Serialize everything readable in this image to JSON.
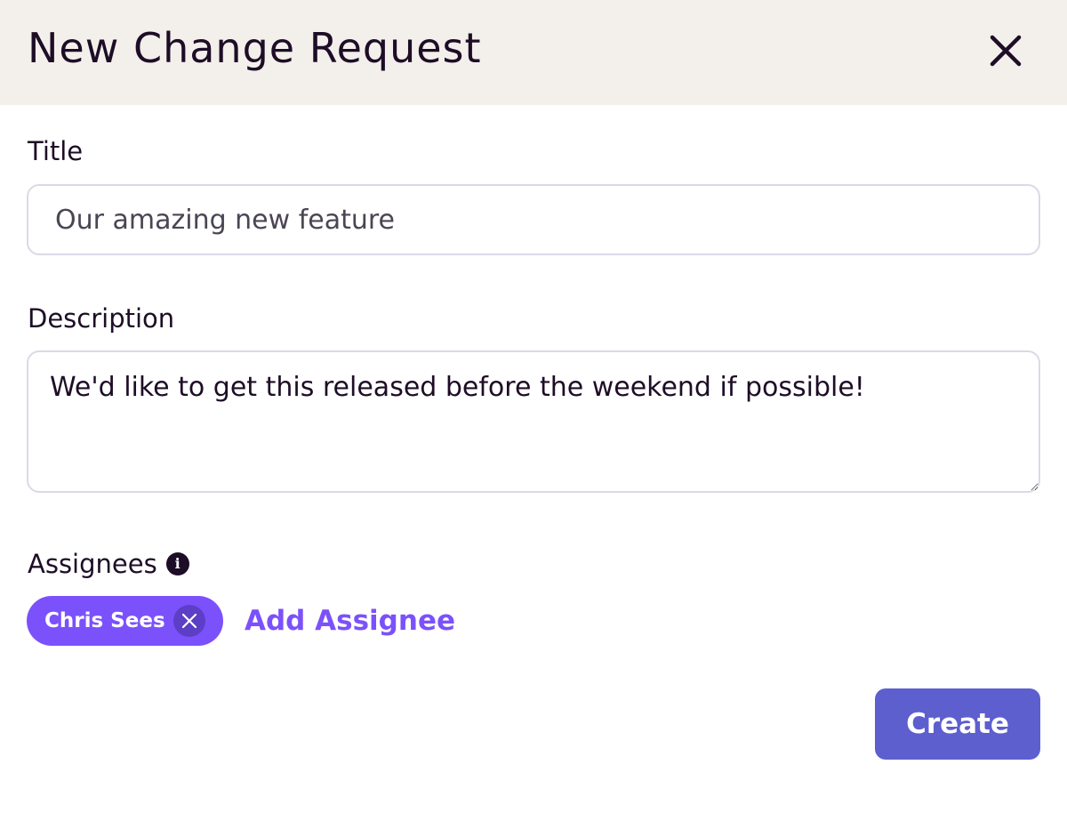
{
  "dialog": {
    "title": "New Change Request",
    "close_icon": "close-icon"
  },
  "form": {
    "title_label": "Title",
    "title_placeholder": "Our amazing new feature",
    "title_value": "",
    "description_label": "Description",
    "description_value": "We'd like to get this released before the weekend if possible!",
    "assignees_label": "Assignees",
    "assignees_info_icon": "info-icon",
    "assignees": [
      {
        "name": "Chris Sees",
        "remove_icon": "close-icon"
      }
    ],
    "add_assignee_label": "Add Assignee",
    "create_label": "Create"
  },
  "colors": {
    "header_bg": "#f3f0ec",
    "text": "#1e0d26",
    "accent_purple": "#7b51fb",
    "chip_remove_bg": "#5c3fc6",
    "primary_button": "#5d5fcf",
    "input_border": "#dcd9e6"
  }
}
